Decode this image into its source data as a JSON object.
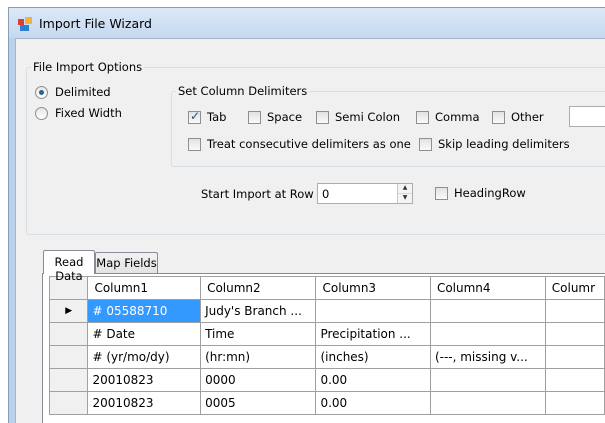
{
  "window": {
    "title": "Import File Wizard"
  },
  "options": {
    "group_title": "File Import Options",
    "radios": [
      {
        "label": "Delimited",
        "checked": true
      },
      {
        "label": "Fixed Width",
        "checked": false
      }
    ]
  },
  "delims": {
    "group_title": "Set Column Delimiters",
    "tab": {
      "label": "Tab",
      "checked": true
    },
    "space": {
      "label": "Space",
      "checked": false
    },
    "semicolon": {
      "label": "Semi Colon",
      "checked": false
    },
    "comma": {
      "label": "Comma",
      "checked": false
    },
    "other": {
      "label": "Other",
      "checked": false,
      "value": ""
    },
    "consecutive": {
      "label": "Treat consecutive delimiters as one",
      "checked": false
    },
    "skip_leading": {
      "label": "Skip leading delimiters",
      "checked": false
    }
  },
  "start": {
    "label": "Start Import at Row",
    "value": "0",
    "heading_row": {
      "label": "HeadingRow",
      "checked": false
    }
  },
  "tabs": [
    "Read Data",
    "Map Fields"
  ],
  "grid": {
    "columns": [
      "Column1",
      "Column2",
      "Column3",
      "Column4",
      "Columr"
    ],
    "rows": [
      [
        "# 05588710",
        "Judy's Branch ...",
        "",
        "",
        ""
      ],
      [
        "# Date",
        "Time",
        "Precipitation ...",
        "",
        ""
      ],
      [
        "# (yr/mo/dy)",
        "(hr:mn)",
        "(inches)",
        "(---, missing v...",
        ""
      ],
      [
        "20010823",
        "0000",
        "0.00",
        "",
        ""
      ],
      [
        "20010823",
        "0005",
        "0.00",
        "",
        ""
      ]
    ],
    "current_row_marker": "▶"
  },
  "icons": {
    "app": "import-wizard-icon",
    "spin_up": "spin-up-icon",
    "spin_down": "spin-down-icon",
    "current_row": "current-row-arrow-icon"
  },
  "colors": {
    "selection": "#3399ff",
    "titlebar": "#c6d9ef"
  }
}
